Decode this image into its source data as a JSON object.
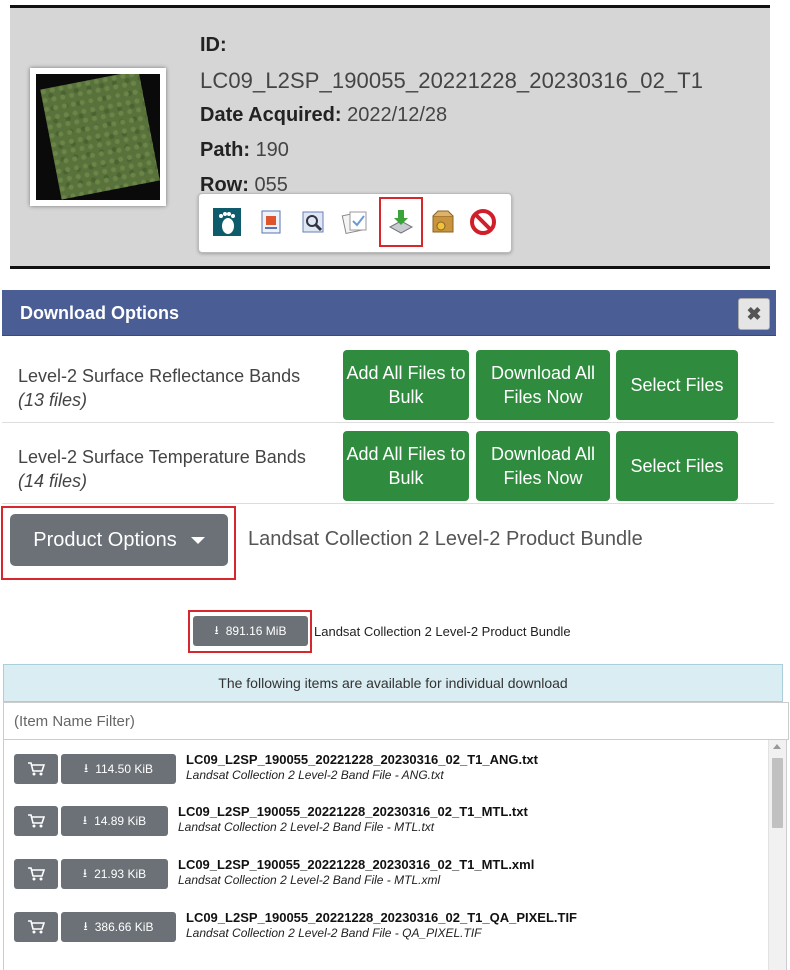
{
  "scene": {
    "id_label": "ID:",
    "id_value": "LC09_L2SP_190055_20221228_20230316_02_T1",
    "date_label": "Date Acquired:",
    "date_value": "2022/12/28",
    "path_label": "Path:",
    "path_value": "190",
    "row_label": "Row:",
    "row_value": "055",
    "tools": [
      "footprint-icon",
      "metadata-icon",
      "browse-overlay-icon",
      "compare-icon",
      "download-icon",
      "order-icon",
      "exclude-icon"
    ],
    "selected_tool": "download-icon"
  },
  "download_options": {
    "title": "Download Options",
    "close_glyph": "✖",
    "bands": [
      {
        "label": "Level-2 Surface Reflectance Bands",
        "count": "(13 files)",
        "add_bulk": "Add All Files to Bulk",
        "download_all": "Download All Files Now",
        "select": "Select Files"
      },
      {
        "label": "Level-2 Surface Temperature Bands",
        "count": "(14 files)",
        "add_bulk": "Add All Files to Bulk",
        "download_all": "Download All Files Now",
        "select": "Select Files"
      }
    ],
    "product_options_label": "Product Options",
    "product_label": "Landsat Collection 2 Level-2 Product Bundle",
    "bundle": {
      "size": "891.16 MiB",
      "label": "Landsat Collection 2 Level-2 Product Bundle"
    },
    "available_banner": "The following items are available for individual download",
    "filter_placeholder": "(Item Name Filter)",
    "files": [
      {
        "size": "114.50 KiB",
        "name": "LC09_L2SP_190055_20221228_20230316_02_T1_ANG.txt",
        "desc": "Landsat Collection 2 Level-2 Band File - ANG.txt"
      },
      {
        "size": "14.89 KiB",
        "name": "LC09_L2SP_190055_20221228_20230316_02_T1_MTL.txt",
        "desc": "Landsat Collection 2 Level-2 Band File - MTL.txt"
      },
      {
        "size": "21.93 KiB",
        "name": "LC09_L2SP_190055_20221228_20230316_02_T1_MTL.xml",
        "desc": "Landsat Collection 2 Level-2 Band File - MTL.xml"
      },
      {
        "size": "386.66 KiB",
        "name": "LC09_L2SP_190055_20221228_20230316_02_T1_QA_PIXEL.TIF",
        "desc": "Landsat Collection 2 Level-2 Band File - QA_PIXEL.TIF"
      }
    ]
  },
  "colors": {
    "header": "#4a5d94",
    "green_button": "#2f8c3e",
    "gray_button": "#6b7177",
    "highlight": "#d8262d",
    "banner": "#d9edf2"
  }
}
